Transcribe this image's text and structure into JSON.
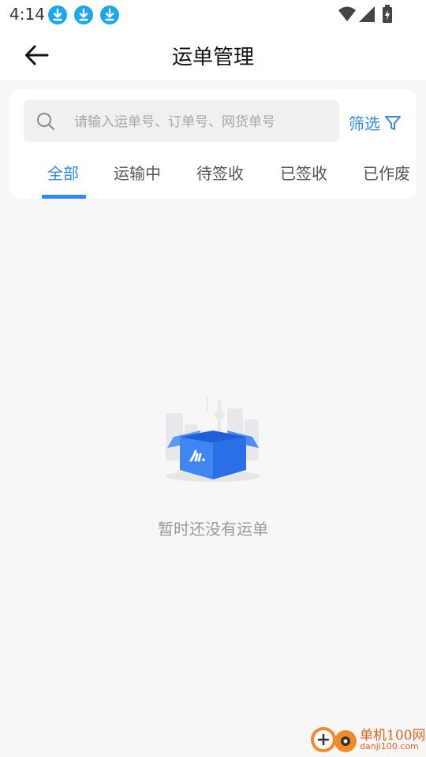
{
  "status_bar": {
    "time": "4:14",
    "notification_icons": [
      "download-icon",
      "download-icon",
      "download-icon"
    ],
    "system_icons": [
      "wifi-icon",
      "signal-icon",
      "battery-charging-icon"
    ],
    "accent_color": "#1aa7f0"
  },
  "header": {
    "back_icon": "arrow-left-icon",
    "title": "运单管理"
  },
  "search": {
    "placeholder": "请输入运单号、订单号、网货单号",
    "value": ""
  },
  "filter": {
    "label": "筛选",
    "icon": "funnel-icon"
  },
  "tabs": [
    {
      "label": "全部",
      "active": true
    },
    {
      "label": "运输中",
      "active": false
    },
    {
      "label": "待签收",
      "active": false
    },
    {
      "label": "已签收",
      "active": false
    },
    {
      "label": "已作废",
      "active": false
    }
  ],
  "empty_state": {
    "illustration": "empty-box-icon",
    "message": "暂时还没有运单"
  },
  "watermark": {
    "title": "单机100网",
    "url": "danji100.com"
  },
  "colors": {
    "primary": "#2f8af2",
    "background": "#f7f7f7",
    "muted_text": "#9a9a9a"
  }
}
